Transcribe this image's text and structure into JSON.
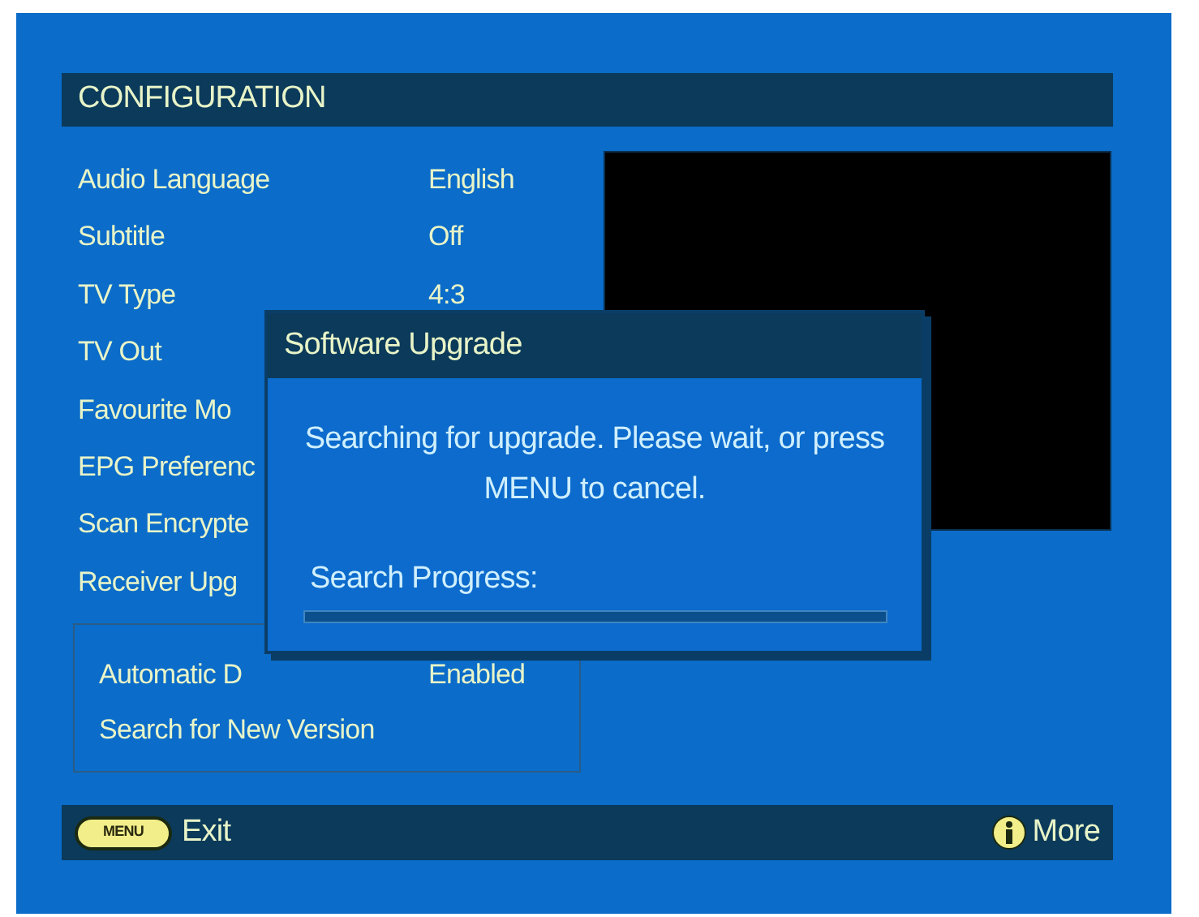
{
  "header": {
    "title": "CONFIGURATION"
  },
  "settings": [
    {
      "label": "Audio Language",
      "value": "English"
    },
    {
      "label": "Subtitle",
      "value": "Off"
    },
    {
      "label": "TV Type",
      "value": "4:3"
    },
    {
      "label": "TV Out"
    },
    {
      "label": "Favourite Mo"
    },
    {
      "label": "EPG Preferenc"
    },
    {
      "label": "Scan Encrypte"
    },
    {
      "label": "Receiver Upg"
    }
  ],
  "submenu": [
    {
      "label": "Automatic D",
      "value": "Enabled"
    },
    {
      "label": "Search for New Version"
    }
  ],
  "dialog": {
    "title": "Software Upgrade",
    "message": "Searching for upgrade. Please wait, or press MENU to cancel.",
    "progress_label": "Search Progress:",
    "level": 0
  },
  "footer": {
    "menu_key": "MENU",
    "exit": "Exit",
    "more": "More"
  }
}
